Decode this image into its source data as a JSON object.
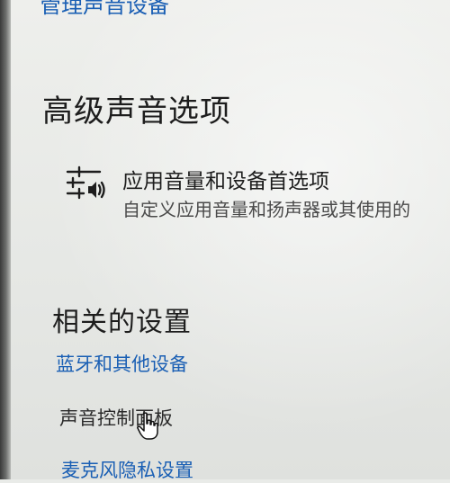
{
  "top_link": "管理声音设备",
  "advanced": {
    "title": "高级声音选项",
    "app_volume": {
      "label": "应用音量和设备首选项",
      "description": "自定义应用音量和扬声器或其使用的"
    }
  },
  "related": {
    "title": "相关的设置",
    "links": [
      {
        "label": "蓝牙和其他设备"
      },
      {
        "label": "声音控制面板"
      },
      {
        "label": "麦克风隐私设置"
      }
    ]
  },
  "colors": {
    "link": "#1a5fb4",
    "text": "#1d1d1d",
    "secondary_text": "#4a4a4a"
  },
  "icons": {
    "app_volume": "sliders-speaker-icon",
    "pointer": "hand-cursor-icon"
  }
}
